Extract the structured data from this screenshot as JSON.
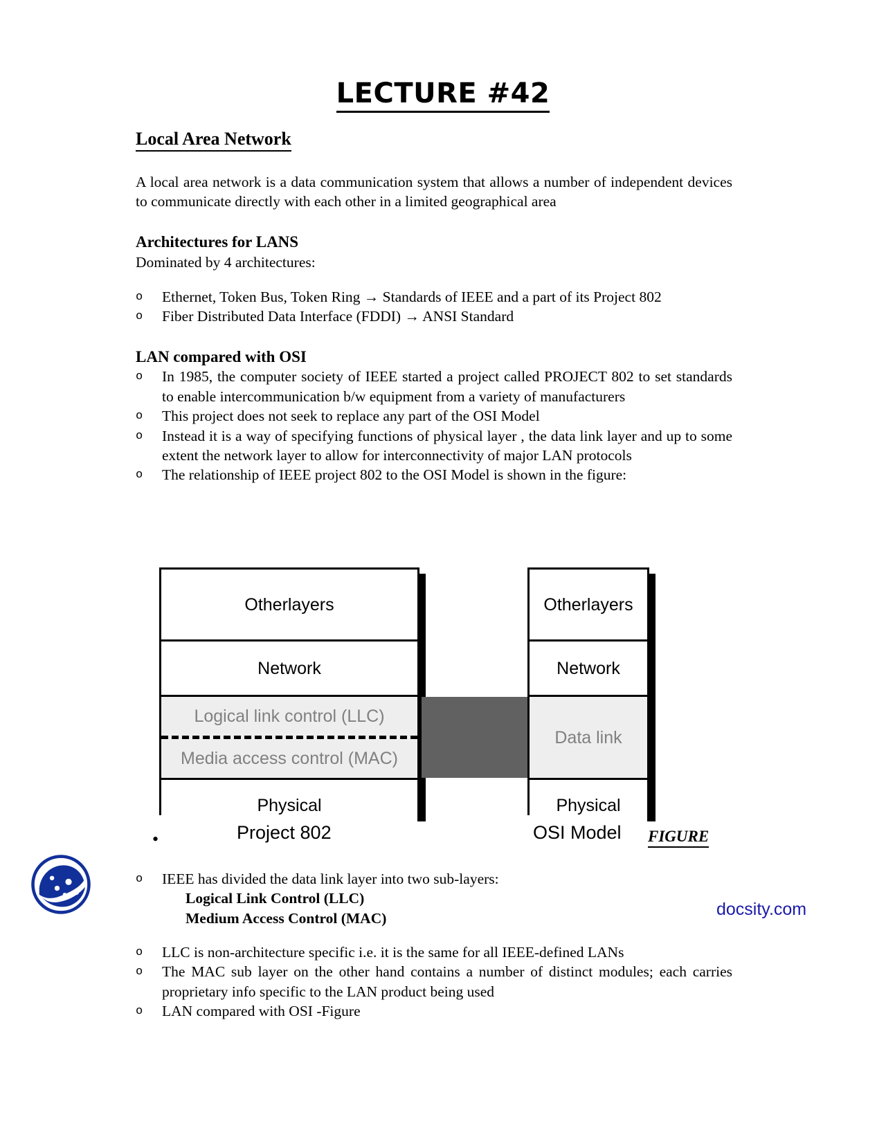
{
  "document": {
    "title": "LECTURE #42",
    "section_heading": "Local Area Network",
    "intro_paragraph": "A local area network is a data communication system that allows a number of independent devices to communicate directly with each other in a limited geographical area",
    "architectures": {
      "heading": "Architectures for LANS",
      "lead": "Dominated by 4 architectures:",
      "items": [
        "Ethernet, Token Bus, Token Ring → Standards of IEEE and a part of its Project 802",
        "Fiber Distributed Data Interface (FDDI) → ANSI Standard"
      ]
    },
    "lan_vs_osi": {
      "heading": "LAN compared with OSI",
      "items": [
        "In 1985, the computer society of IEEE started a project called PROJECT 802 to set standards to enable intercommunication b/w equipment from a variety of manufacturers",
        "This project does not seek to replace any part of the OSI Model",
        "Instead it is a way of specifying functions of physical layer , the data link layer and up to some extent the network layer to allow for interconnectivity of major LAN protocols",
        "The relationship of IEEE project 802 to the OSI Model is shown in the figure:"
      ]
    },
    "sublayers": {
      "lead": "IEEE has divided the data link layer into two sub-layers:",
      "items": [
        "Logical Link Control (LLC)",
        "Medium Access Control (MAC)"
      ]
    },
    "closing_items": [
      "LLC is non-architecture specific i.e. it is the same for all IEEE-defined LANs",
      "The MAC sub layer on the other hand contains a number of distinct modules; each carries proprietary info specific to the LAN product being used",
      "LAN compared with OSI -Figure"
    ],
    "bullet_marker": "o",
    "figure_bullet_marker": "•"
  },
  "figure": {
    "label": "FIGURE",
    "project802": {
      "caption": "Project 802",
      "layers": [
        "Other\nlayers",
        "Network",
        "Logical link control (LLC)",
        "Media access control (MAC)",
        "Physical"
      ],
      "other_layers_line1": "Other",
      "other_layers_line2": "layers",
      "network": "Network",
      "llc": "Logical link control (LLC)",
      "mac": "Media access control (MAC)",
      "physical": "Physical"
    },
    "osi": {
      "caption": "OSI Model",
      "other_layers_line1": "Other",
      "other_layers_line2": "layers",
      "network": "Network",
      "data_link": "Data link",
      "physical": "Physical"
    },
    "colors": {
      "highlight_cell_bg": "#eeeeee",
      "highlight_cell_text": "#808080",
      "connector_block": "#616161",
      "border": "#000000"
    }
  },
  "branding": {
    "watermark_text": "docsity.com",
    "watermark_color": "#1a1aa8",
    "logo_name": "docsity-logo"
  }
}
